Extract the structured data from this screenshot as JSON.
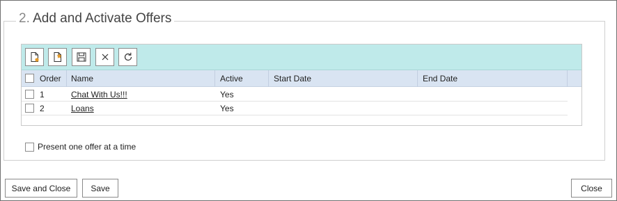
{
  "section": {
    "number": "2.",
    "title": "Add and Activate Offers"
  },
  "toolbar": {
    "buttons": [
      {
        "icon": "new-offer-icon"
      },
      {
        "icon": "add-existing-offer-icon"
      },
      {
        "icon": "save-icon"
      },
      {
        "icon": "delete-icon"
      },
      {
        "icon": "refresh-icon"
      }
    ]
  },
  "grid": {
    "columns": {
      "order": "Order",
      "name": "Name",
      "active": "Active",
      "start_date": "Start Date",
      "end_date": "End Date"
    },
    "rows": [
      {
        "order": "1",
        "name": "Chat With Us!!!",
        "active": "Yes",
        "start_date": "",
        "end_date": ""
      },
      {
        "order": "2",
        "name": "Loans",
        "active": "Yes",
        "start_date": "",
        "end_date": ""
      }
    ]
  },
  "options": {
    "present_one_label": "Present one offer at a time",
    "present_one_checked": false
  },
  "footer": {
    "save_and_close": "Save and Close",
    "save": "Save",
    "close": "Close"
  },
  "colors": {
    "toolbar_bg": "#bfeaea",
    "header_bg": "#d9e4f2"
  }
}
